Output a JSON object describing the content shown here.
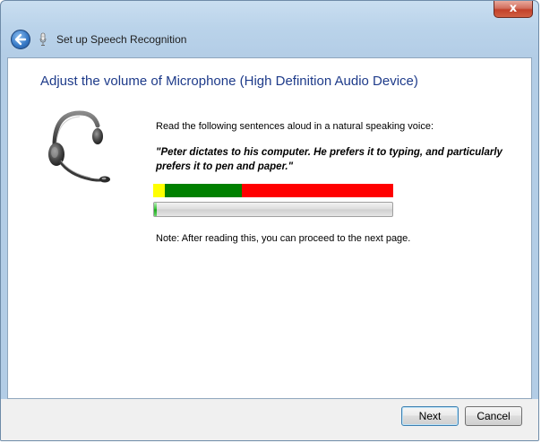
{
  "window": {
    "title": "Set up Speech Recognition",
    "close_label": "x"
  },
  "content": {
    "heading": "Adjust the volume of Microphone (High Definition Audio Device)",
    "instruction": "Read the following sentences aloud in a natural speaking voice:",
    "quote": "\"Peter dictates to his computer. He prefers it to typing, and particularly prefers it to pen and paper.\"",
    "note": "Note: After reading this, you can proceed to the next page.",
    "volume_zones": [
      {
        "name": "low",
        "color": "#ffff00",
        "fraction": 0.05
      },
      {
        "name": "good",
        "color": "#008000",
        "fraction": 0.32
      },
      {
        "name": "loud",
        "color": "#ff0000",
        "fraction": 0.63
      }
    ],
    "input_level": 0.01
  },
  "buttons": {
    "next": "Next",
    "cancel": "Cancel"
  },
  "icons": {
    "back": "back-arrow-icon",
    "microphone": "microphone-icon",
    "headset": "headset-icon"
  },
  "colors": {
    "heading": "#1e3b8a",
    "progress_fill": "#2fbf2f"
  }
}
